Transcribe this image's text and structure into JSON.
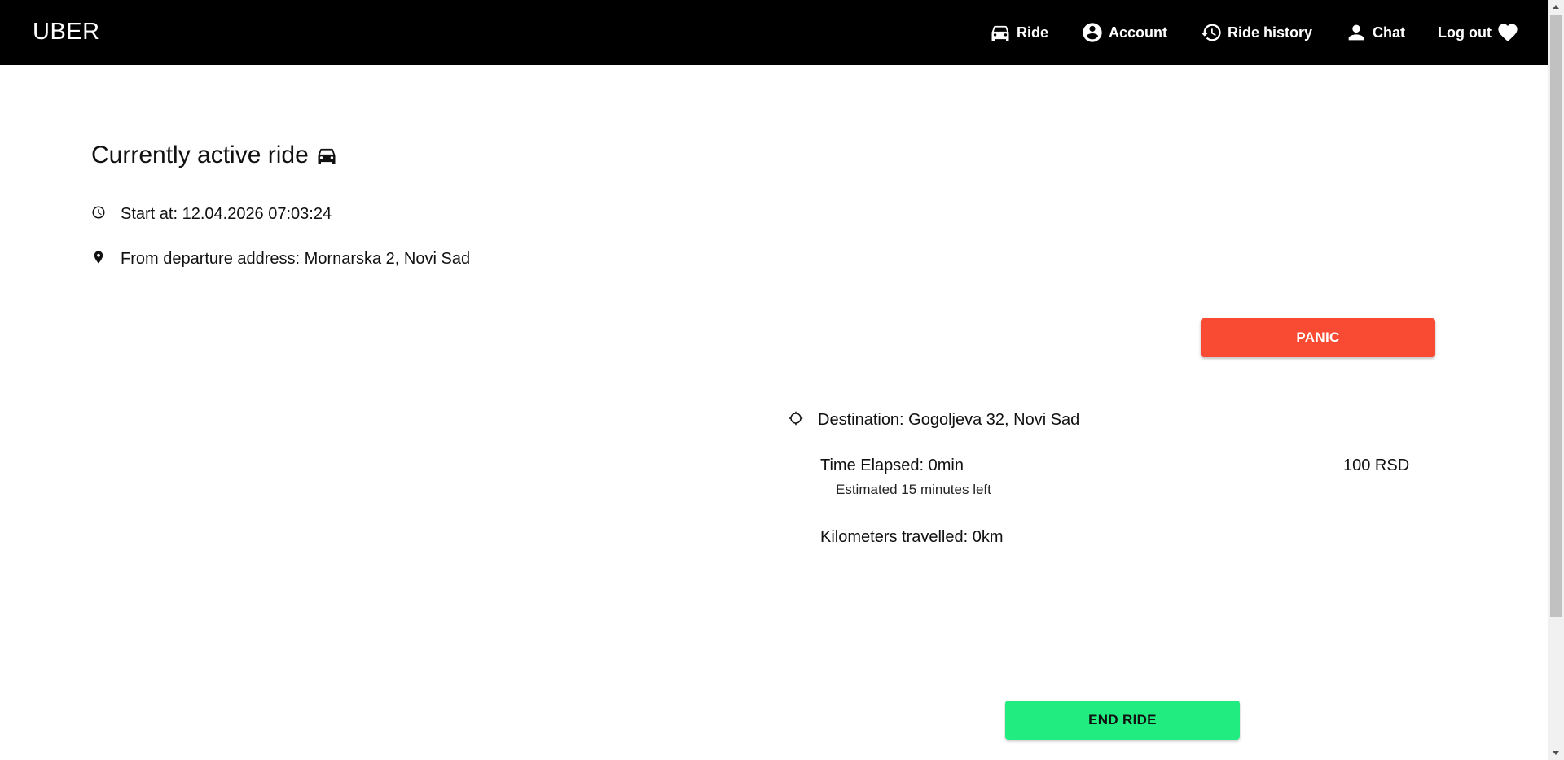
{
  "header": {
    "brand": "UBER",
    "nav": [
      {
        "label": "Ride",
        "icon": "car-icon"
      },
      {
        "label": "Account",
        "icon": "account-circle-icon"
      },
      {
        "label": "Ride history",
        "icon": "history-icon"
      },
      {
        "label": "Chat",
        "icon": "person-icon"
      },
      {
        "label": "Log out",
        "icon": "heart-icon"
      }
    ]
  },
  "ride": {
    "title": "Currently active ride",
    "title_icon": "car-icon",
    "start": "Start at: 12.04.2026 07:03:24",
    "from": "From departure address: Mornarska 2, Novi Sad",
    "panic_label": "PANIC",
    "destination": "Destination: Gogoljeva 32, Novi Sad",
    "time_elapsed": "Time Elapsed: 0min",
    "price": "100 RSD",
    "estimate": "Estimated 15 minutes left",
    "km_travelled": "Kilometers travelled: 0km",
    "end_label": "END RIDE"
  },
  "colors": {
    "header_bg": "#000000",
    "panic": "#f94b33",
    "end_ride": "#21ec80"
  }
}
